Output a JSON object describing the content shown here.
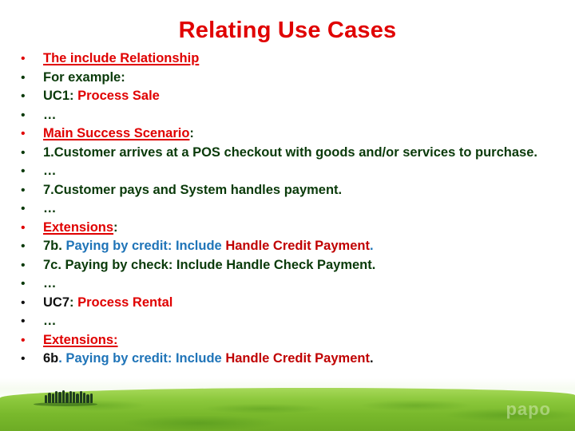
{
  "slide": {
    "title": "Relating Use Cases"
  },
  "colors": {
    "title": "#e00000",
    "heading_red": "#e00000",
    "dark_red": "#c00000",
    "dark_green": "#0a3a0a",
    "blue": "#1f74b8",
    "black": "#111111"
  },
  "bullets": [
    {
      "bullet_color": "red",
      "segments": [
        {
          "text": "The include Relationship",
          "style": "red ul"
        }
      ]
    },
    {
      "bullet_color": "green",
      "segments": [
        {
          "text": "For example:",
          "style": "green"
        }
      ]
    },
    {
      "bullet_color": "green",
      "segments": [
        {
          "text": "UC1",
          "style": "green"
        },
        {
          "text": ": ",
          "style": "green"
        },
        {
          "text": "Process Sale",
          "style": "red"
        }
      ]
    },
    {
      "bullet_color": "green",
      "segments": [
        {
          "text": "…",
          "style": "green"
        }
      ]
    },
    {
      "bullet_color": "red",
      "segments": [
        {
          "text": "Main Success Scenario",
          "style": "red ul"
        },
        {
          "text": ":",
          "style": "green"
        }
      ]
    },
    {
      "bullet_color": "green",
      "segments": [
        {
          "text": "1.Customer arrives at a POS checkout with goods and/or services to purchase.",
          "style": "green"
        }
      ]
    },
    {
      "bullet_color": "green",
      "segments": [
        {
          "text": "…",
          "style": "green"
        }
      ]
    },
    {
      "bullet_color": "green",
      "segments": [
        {
          "text": "7.Customer pays and System handles payment.",
          "style": "green"
        }
      ]
    },
    {
      "bullet_color": "green",
      "segments": [
        {
          "text": "…",
          "style": "green"
        }
      ]
    },
    {
      "bullet_color": "red",
      "segments": [
        {
          "text": "Extensions",
          "style": "red ul"
        },
        {
          "text": ":",
          "style": "green"
        }
      ]
    },
    {
      "bullet_color": "green",
      "segments": [
        {
          "text": "7b. ",
          "style": "green"
        },
        {
          "text": "Paying by credit: Include ",
          "style": "blue"
        },
        {
          "text": "Handle Credit Payment",
          "style": "darkred"
        },
        {
          "text": ".",
          "style": "blue"
        }
      ]
    },
    {
      "bullet_color": "green",
      "segments": [
        {
          "text": "7c. Paying by check: Include Handle Check Payment.",
          "style": "green"
        }
      ]
    },
    {
      "bullet_color": "green",
      "segments": [
        {
          "text": "…",
          "style": "green"
        }
      ]
    },
    {
      "bullet_color": "black",
      "segments": [
        {
          "text": "UC7",
          "style": "black"
        },
        {
          "text": ": ",
          "style": "green"
        },
        {
          "text": "Process Rental",
          "style": "red"
        }
      ]
    },
    {
      "bullet_color": "black",
      "segments": [
        {
          "text": "…",
          "style": "green"
        }
      ]
    },
    {
      "bullet_color": "red",
      "segments": [
        {
          "text": "Extensions:",
          "style": "red ul"
        }
      ]
    },
    {
      "bullet_color": "black",
      "segments": [
        {
          "text": "6b",
          "style": "black"
        },
        {
          "text": ". Paying by credit: Include ",
          "style": "blue"
        },
        {
          "text": "Handle Credit Payment",
          "style": "darkred"
        },
        {
          "text": ".",
          "style": "black"
        }
      ]
    }
  ],
  "footer": {
    "watermark": "papo",
    "background_image": "green-hills-with-trees"
  }
}
